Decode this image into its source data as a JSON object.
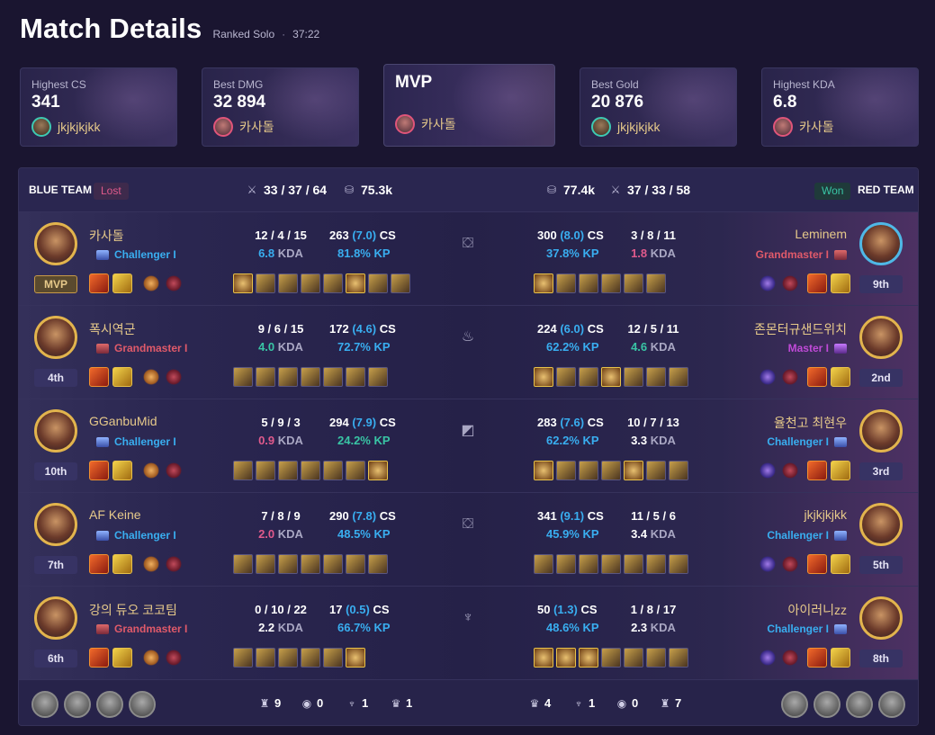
{
  "header": {
    "title": "Match Details",
    "queue": "Ranked Solo",
    "separator": "·",
    "duration": "37:22"
  },
  "cards": [
    {
      "label": "Highest CS",
      "value": "341",
      "player": "jkjkjkjkk",
      "ring": "teal"
    },
    {
      "label": "Best DMG",
      "value": "32 894",
      "player": "카사돌",
      "ring": "pink"
    },
    {
      "label": "",
      "value": "MVP",
      "player": "카사돌",
      "ring": "pink"
    },
    {
      "label": "Best Gold",
      "value": "20 876",
      "player": "jkjkjkjkk",
      "ring": "teal"
    },
    {
      "label": "Highest KDA",
      "value": "6.8",
      "player": "카사돌",
      "ring": "pink"
    }
  ],
  "blue": {
    "label": "BLUE TEAM",
    "result": "Lost",
    "kda": "33 / 37 / 64",
    "gold": "75.3k"
  },
  "red": {
    "label": "RED TEAM",
    "result": "Won",
    "kda": "37 / 33 / 58",
    "gold": "77.4k"
  },
  "rows": [
    {
      "lane": "top",
      "b": {
        "name": "카사돌",
        "tier": "Challenger I",
        "tierClass": "ch",
        "rank": "MVP",
        "k": "12 / 4 / 15",
        "kdaR": "6.8",
        "kdaColor": "#39aef0",
        "cs": "263",
        "csp": "(7.0)",
        "kp": "81.8% KP"
      },
      "r": {
        "name": "Leminem",
        "tier": "Grandmaster I",
        "tierClass": "gm",
        "rank": "9th",
        "k": "3 / 8 / 11",
        "kdaR": "1.8",
        "kdaColor": "#e05a8c",
        "cs": "300",
        "csp": "(8.0)",
        "kp": "37.8% KP",
        "blue": true
      }
    },
    {
      "lane": "jungle",
      "b": {
        "name": "폭시역군",
        "tier": "Grandmaster I",
        "tierClass": "gm",
        "rank": "4th",
        "k": "9 / 6 / 15",
        "kdaR": "4.0",
        "kdaColor": "#39c5a5",
        "cs": "172",
        "csp": "(4.6)",
        "kp": "72.7% KP"
      },
      "r": {
        "name": "존몬터규샌드위치",
        "tier": "Master I",
        "tierClass": "ma",
        "rank": "2nd",
        "k": "12 / 5 / 11",
        "kdaR": "4.6",
        "kdaColor": "#39c5a5",
        "cs": "224",
        "csp": "(6.0)",
        "kp": "62.2% KP"
      }
    },
    {
      "lane": "mid",
      "b": {
        "name": "GGanbuMid",
        "tier": "Challenger I",
        "tierClass": "ch",
        "rank": "10th",
        "k": "5 / 9 / 3",
        "kdaR": "0.9",
        "kdaColor": "#e05a8c",
        "cs": "294",
        "csp": "(7.9)",
        "kp": "24.2% KP",
        "kpColor": "#39c5a5"
      },
      "r": {
        "name": "율천고 최현우",
        "tier": "Challenger I",
        "tierClass": "ch",
        "rank": "3rd",
        "k": "10 / 7 / 13",
        "kdaR": "3.3",
        "kdaColor": "#ffffff",
        "cs": "283",
        "csp": "(7.6)",
        "kp": "62.2% KP"
      }
    },
    {
      "lane": "bot",
      "b": {
        "name": "AF Keine",
        "tier": "Challenger I",
        "tierClass": "ch",
        "rank": "7th",
        "k": "7 / 8 / 9",
        "kdaR": "2.0",
        "kdaColor": "#e05a8c",
        "cs": "290",
        "csp": "(7.8)",
        "kp": "48.5% KP"
      },
      "r": {
        "name": "jkjkjkjkk",
        "tier": "Challenger I",
        "tierClass": "ch",
        "rank": "5th",
        "k": "11 / 5 / 6",
        "kdaR": "3.4",
        "kdaColor": "#ffffff",
        "cs": "341",
        "csp": "(9.1)",
        "kp": "45.9% KP"
      }
    },
    {
      "lane": "support",
      "b": {
        "name": "강의 듀오 코코팀",
        "tier": "Grandmaster I",
        "tierClass": "gm",
        "rank": "6th",
        "k": "0 / 10 / 22",
        "kdaR": "2.2",
        "kdaColor": "#ffffff",
        "cs": "17",
        "csp": "(0.5)",
        "kp": "66.7% KP"
      },
      "r": {
        "name": "아이러니zz",
        "tier": "Challenger I",
        "tierClass": "ch",
        "rank": "8th",
        "k": "1 / 8 / 17",
        "kdaR": "2.3",
        "kdaColor": "#ffffff",
        "cs": "50",
        "csp": "(1.3)",
        "kp": "48.6% KP"
      }
    }
  ],
  "labels": {
    "cs": "CS",
    "kda": "KDA"
  },
  "objectives": {
    "blue": {
      "towers": "9",
      "heralds": "0",
      "drakes": "1",
      "barons": "1"
    },
    "red": {
      "barons": "4",
      "drakes": "1",
      "heralds": "0",
      "towers": "7"
    }
  }
}
